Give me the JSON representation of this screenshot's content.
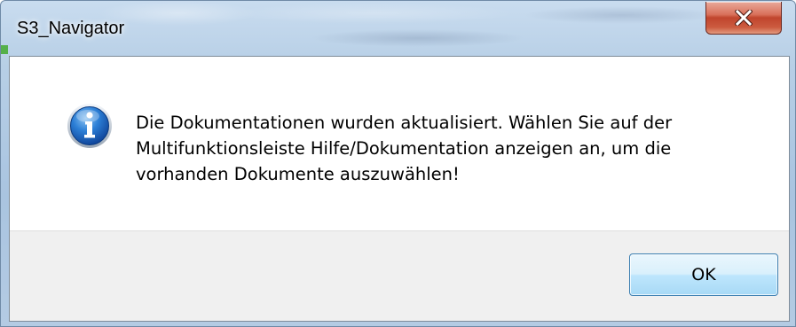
{
  "window": {
    "title": "S3_Navigator"
  },
  "dialog": {
    "icon": "information-icon",
    "message": "Die Dokumentationen wurden aktualisiert. Wählen Sie auf der\nMultifunktionsleiste Hilfe/Dokumentation anzeigen an, um die\nvorhanden Dokumente auszuwählen!"
  },
  "buttons": {
    "ok_label": "OK",
    "close_icon": "close-icon"
  },
  "colors": {
    "close_button": "#c0452d",
    "ok_button_border": "#3c7fb1",
    "button_area": "#f0f0f0"
  }
}
